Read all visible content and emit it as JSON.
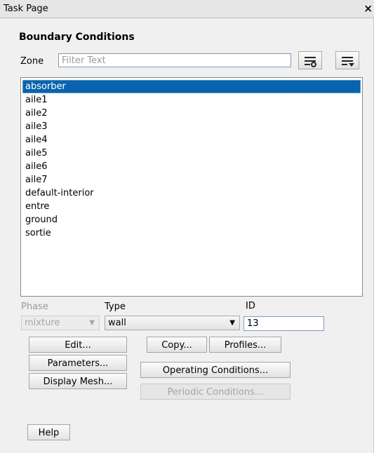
{
  "window": {
    "title": "Task Page",
    "close_glyph": "×"
  },
  "panel": {
    "heading": "Boundary Conditions"
  },
  "zone": {
    "label": "Zone",
    "filter_placeholder": "Filter Text",
    "filter_value": "",
    "filter_button_icon": "filter-settings-icon",
    "list_options_icon": "list-options-icon"
  },
  "zones": [
    {
      "label": "absorber",
      "selected": true
    },
    {
      "label": "aile1"
    },
    {
      "label": "aile2"
    },
    {
      "label": "aile3"
    },
    {
      "label": "aile4"
    },
    {
      "label": "aile5"
    },
    {
      "label": "aile6"
    },
    {
      "label": "aile7"
    },
    {
      "label": "default-interior"
    },
    {
      "label": "entre"
    },
    {
      "label": "ground"
    },
    {
      "label": "sortie"
    }
  ],
  "phase": {
    "label": "Phase",
    "value": "mixture",
    "disabled": true
  },
  "type": {
    "label": "Type",
    "value": "wall"
  },
  "id": {
    "label": "ID",
    "value": "13"
  },
  "buttons": {
    "edit": "Edit...",
    "copy": "Copy...",
    "profiles": "Profiles...",
    "parameters": "Parameters...",
    "operating_conditions": "Operating Conditions...",
    "display_mesh": "Display Mesh...",
    "periodic_conditions": "Periodic Conditions...",
    "help": "Help"
  },
  "colors": {
    "selection": "#0a64ad",
    "panel_bg": "#f0f0f0"
  }
}
